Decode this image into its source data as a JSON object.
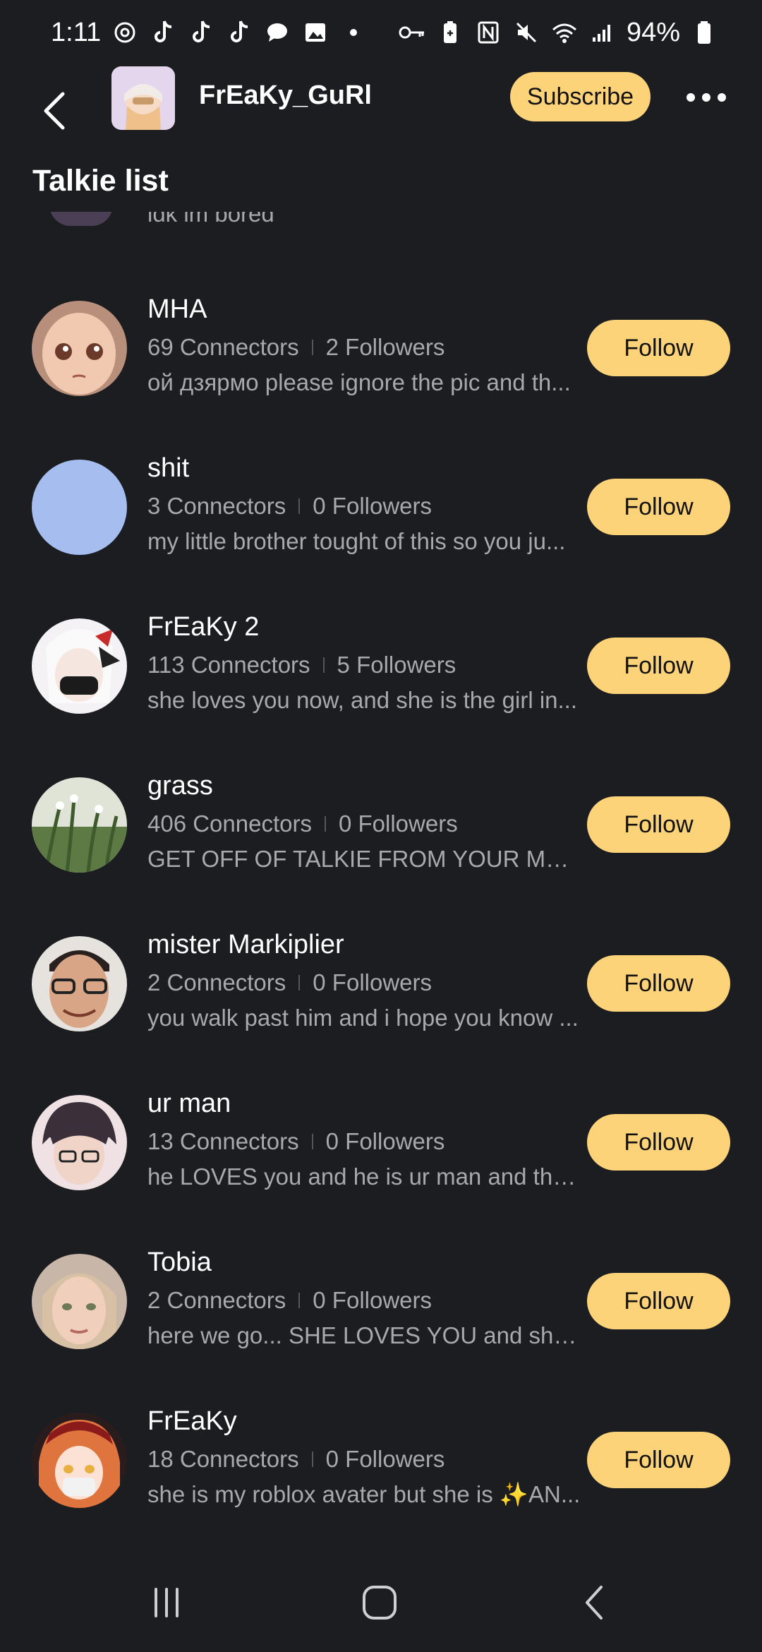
{
  "status": {
    "time": "1:11",
    "battery": "94%",
    "left_icons": [
      "threads-icon",
      "tiktok-icon",
      "tiktok-icon",
      "tiktok-icon",
      "chat-icon",
      "image-icon",
      "dot-icon"
    ],
    "right_icons": [
      "key-icon",
      "battery-saver-icon",
      "nfc-icon",
      "mute-icon",
      "wifi-icon",
      "signal-icon",
      "battery-icon"
    ]
  },
  "header": {
    "username": "FrEaKy_GuRl",
    "subscribe_label": "Subscribe"
  },
  "section_title": "Talkie list",
  "partial_row_text": "idk im bored",
  "rows": [
    {
      "name": "MHA",
      "connectors": "69 Connectors",
      "followers": "2 Followers",
      "desc": "ой дзярмо please ignore the pic and th...",
      "follow_label": "Follow",
      "avatar_color": "#c9a08a"
    },
    {
      "name": "shit",
      "connectors": "3 Connectors",
      "followers": "0 Followers",
      "desc": "my little brother tought of this so you ju...",
      "follow_label": "Follow",
      "avatar_color": "#a6bdf0"
    },
    {
      "name": "FrEaKy 2",
      "connectors": "113 Connectors",
      "followers": "5 Followers",
      "desc": "she loves you now, and she is the girl in...",
      "follow_label": "Follow",
      "avatar_color": "#e9e6ea"
    },
    {
      "name": "grass",
      "connectors": "406 Connectors",
      "followers": "0 Followers",
      "desc": "GET OFF OF TALKIE FROM YOUR MOM...",
      "follow_label": "Follow",
      "avatar_color": "#7f9a6a"
    },
    {
      "name": "mister Markiplier",
      "connectors": "2 Connectors",
      "followers": "0 Followers",
      "desc": "you walk past him and i hope you know ...",
      "follow_label": "Follow",
      "avatar_color": "#d7a88a"
    },
    {
      "name": "ur man",
      "connectors": "13 Connectors",
      "followers": "0 Followers",
      "desc": "he LOVES you and he is ur man and tha...",
      "follow_label": "Follow",
      "avatar_color": "#6b5d6e"
    },
    {
      "name": "Tobia",
      "connectors": "2 Connectors",
      "followers": "0 Followers",
      "desc": "here we go... SHE LOVES YOU and she i...",
      "follow_label": "Follow",
      "avatar_color": "#d9b8a7"
    },
    {
      "name": "FrEaKy",
      "connectors": "18 Connectors",
      "followers": "0 Followers",
      "desc": "she is my roblox avater but she is ✨AN...",
      "follow_label": "Follow",
      "avatar_color": "#e07a4a"
    }
  ],
  "colors": {
    "background": "#1c1d21",
    "accent": "#fdd37a",
    "secondary_text": "#a8a9ad"
  }
}
